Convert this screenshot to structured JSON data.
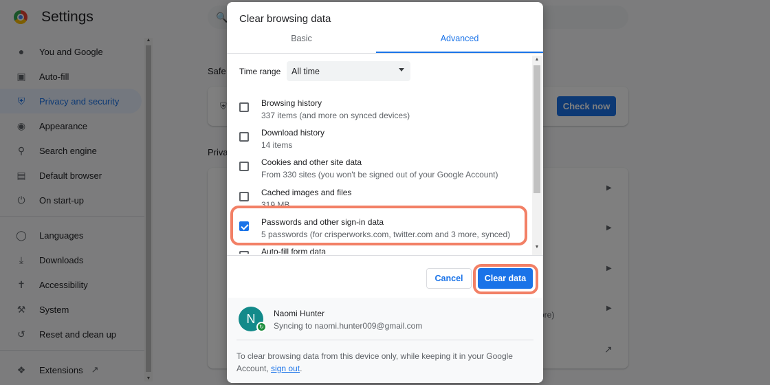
{
  "app": {
    "title": "Settings"
  },
  "sidebar": {
    "items": [
      {
        "label": "You and Google",
        "icon": "person-icon"
      },
      {
        "label": "Auto-fill",
        "icon": "clipboard-icon"
      },
      {
        "label": "Privacy and security",
        "icon": "shield-icon",
        "active": true
      },
      {
        "label": "Appearance",
        "icon": "palette-icon"
      },
      {
        "label": "Search engine",
        "icon": "search-icon"
      },
      {
        "label": "Default browser",
        "icon": "browser-icon"
      },
      {
        "label": "On start-up",
        "icon": "power-icon"
      },
      {
        "label": "Languages",
        "icon": "globe-icon"
      },
      {
        "label": "Downloads",
        "icon": "download-icon"
      },
      {
        "label": "Accessibility",
        "icon": "accessibility-icon"
      },
      {
        "label": "System",
        "icon": "wrench-icon"
      },
      {
        "label": "Reset and clean up",
        "icon": "history-icon"
      },
      {
        "label": "Extensions",
        "icon": "puzzle-icon"
      }
    ]
  },
  "background": {
    "safety_label": "Safe",
    "privacy_label": "Priva",
    "check_now": "Check now",
    "more_text": "ore)"
  },
  "dialog": {
    "title": "Clear browsing data",
    "tabs": {
      "basic": "Basic",
      "advanced": "Advanced"
    },
    "time_range": {
      "label": "Time range",
      "value": "All time"
    },
    "items": [
      {
        "name": "Browsing history",
        "desc": "337 items (and more on synced devices)",
        "checked": false
      },
      {
        "name": "Download history",
        "desc": "14 items",
        "checked": false
      },
      {
        "name": "Cookies and other site data",
        "desc": "From 330 sites (you won't be signed out of your Google Account)",
        "checked": false
      },
      {
        "name": "Cached images and files",
        "desc": "319 MB",
        "checked": false
      },
      {
        "name": "Passwords and other sign-in data",
        "desc": "5 passwords (for crisperworks.com, twitter.com and 3 more, synced)",
        "checked": true
      },
      {
        "name": "Auto-fill form data",
        "desc": "",
        "checked": false
      }
    ],
    "buttons": {
      "cancel": "Cancel",
      "clear": "Clear data"
    },
    "account": {
      "initial": "N",
      "name": "Naomi Hunter",
      "status": "Syncing to naomi.hunter009@gmail.com"
    },
    "footer": {
      "text": "To clear browsing data from this device only, while keeping it in your Google Account, ",
      "link": "sign out",
      "end": "."
    }
  },
  "colors": {
    "accent": "#1a73e8",
    "highlight": "#f28066",
    "avatar": "#138a8a"
  }
}
